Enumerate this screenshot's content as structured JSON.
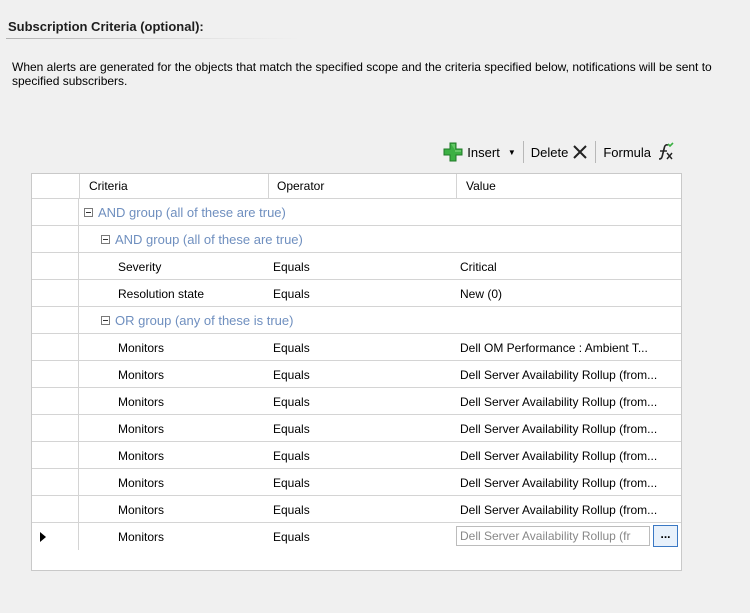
{
  "section": {
    "title": "Subscription Criteria (optional):",
    "description": "When alerts are generated for the objects that match the specified scope and the criteria specified below, notifications will be sent to specified subscribers."
  },
  "toolbar": {
    "insert_label": "Insert",
    "delete_label": "Delete",
    "formula_label": "Formula"
  },
  "grid": {
    "headers": {
      "criteria": "Criteria",
      "operator": "Operator",
      "value": "Value"
    },
    "groups": [
      "AND group (all of these are true)",
      "AND group (all of these are true)",
      "OR group (any of these is true)"
    ],
    "rows": [
      {
        "criteria": "Severity",
        "operator": "Equals",
        "value": "Critical"
      },
      {
        "criteria": "Resolution state",
        "operator": "Equals",
        "value": "New (0)"
      },
      {
        "criteria": "Monitors",
        "operator": "Equals",
        "value": "Dell OM Performance : Ambient T..."
      },
      {
        "criteria": "Monitors",
        "operator": "Equals",
        "value": "Dell Server Availability Rollup (from..."
      },
      {
        "criteria": "Monitors",
        "operator": "Equals",
        "value": "Dell Server Availability Rollup (from..."
      },
      {
        "criteria": "Monitors",
        "operator": "Equals",
        "value": "Dell Server Availability Rollup (from..."
      },
      {
        "criteria": "Monitors",
        "operator": "Equals",
        "value": "Dell Server Availability Rollup (from..."
      },
      {
        "criteria": "Monitors",
        "operator": "Equals",
        "value": "Dell Server Availability Rollup (from..."
      },
      {
        "criteria": "Monitors",
        "operator": "Equals",
        "value": "Dell Server Availability Rollup (from..."
      },
      {
        "criteria": "Monitors",
        "operator": "Equals",
        "value": "Dell Server Availability Rollup (fr"
      }
    ],
    "ellipsis_label": "..."
  },
  "colors": {
    "group_text": "#6f8fbf",
    "insert_icon": "#3cb043",
    "button_border": "#3a78c4"
  }
}
